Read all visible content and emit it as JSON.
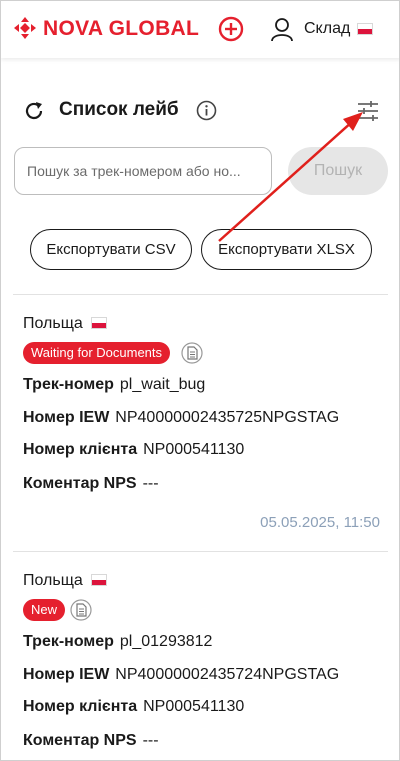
{
  "header": {
    "logo_text": "NOVA GLOBAL",
    "user_label": "Склад",
    "brand_color": "#e5202e"
  },
  "toolbar": {
    "title": "Список лейб"
  },
  "search": {
    "placeholder": "Пошук за трек-номером або но...",
    "button_label": "Пошук"
  },
  "export": {
    "csv_label": "Експортувати CSV",
    "xlsx_label": "Експортувати XLSX"
  },
  "labels": {
    "tracking": "Трек-номер",
    "iew": "Номер IEW",
    "client": "Номер клієнта",
    "comment": "Коментар NPS"
  },
  "items": [
    {
      "country": "Польща",
      "status": "Waiting for Documents",
      "tracking": "pl_wait_bug",
      "iew": "NP40000002435725NPGSTAG",
      "client": "NP000541130",
      "comment": "---",
      "date": "05.05.2025, 11:50"
    },
    {
      "country": "Польща",
      "status": "New",
      "tracking": "pl_01293812",
      "iew": "NP40000002435724NPGSTAG",
      "client": "NP000541130",
      "comment": "---"
    }
  ]
}
